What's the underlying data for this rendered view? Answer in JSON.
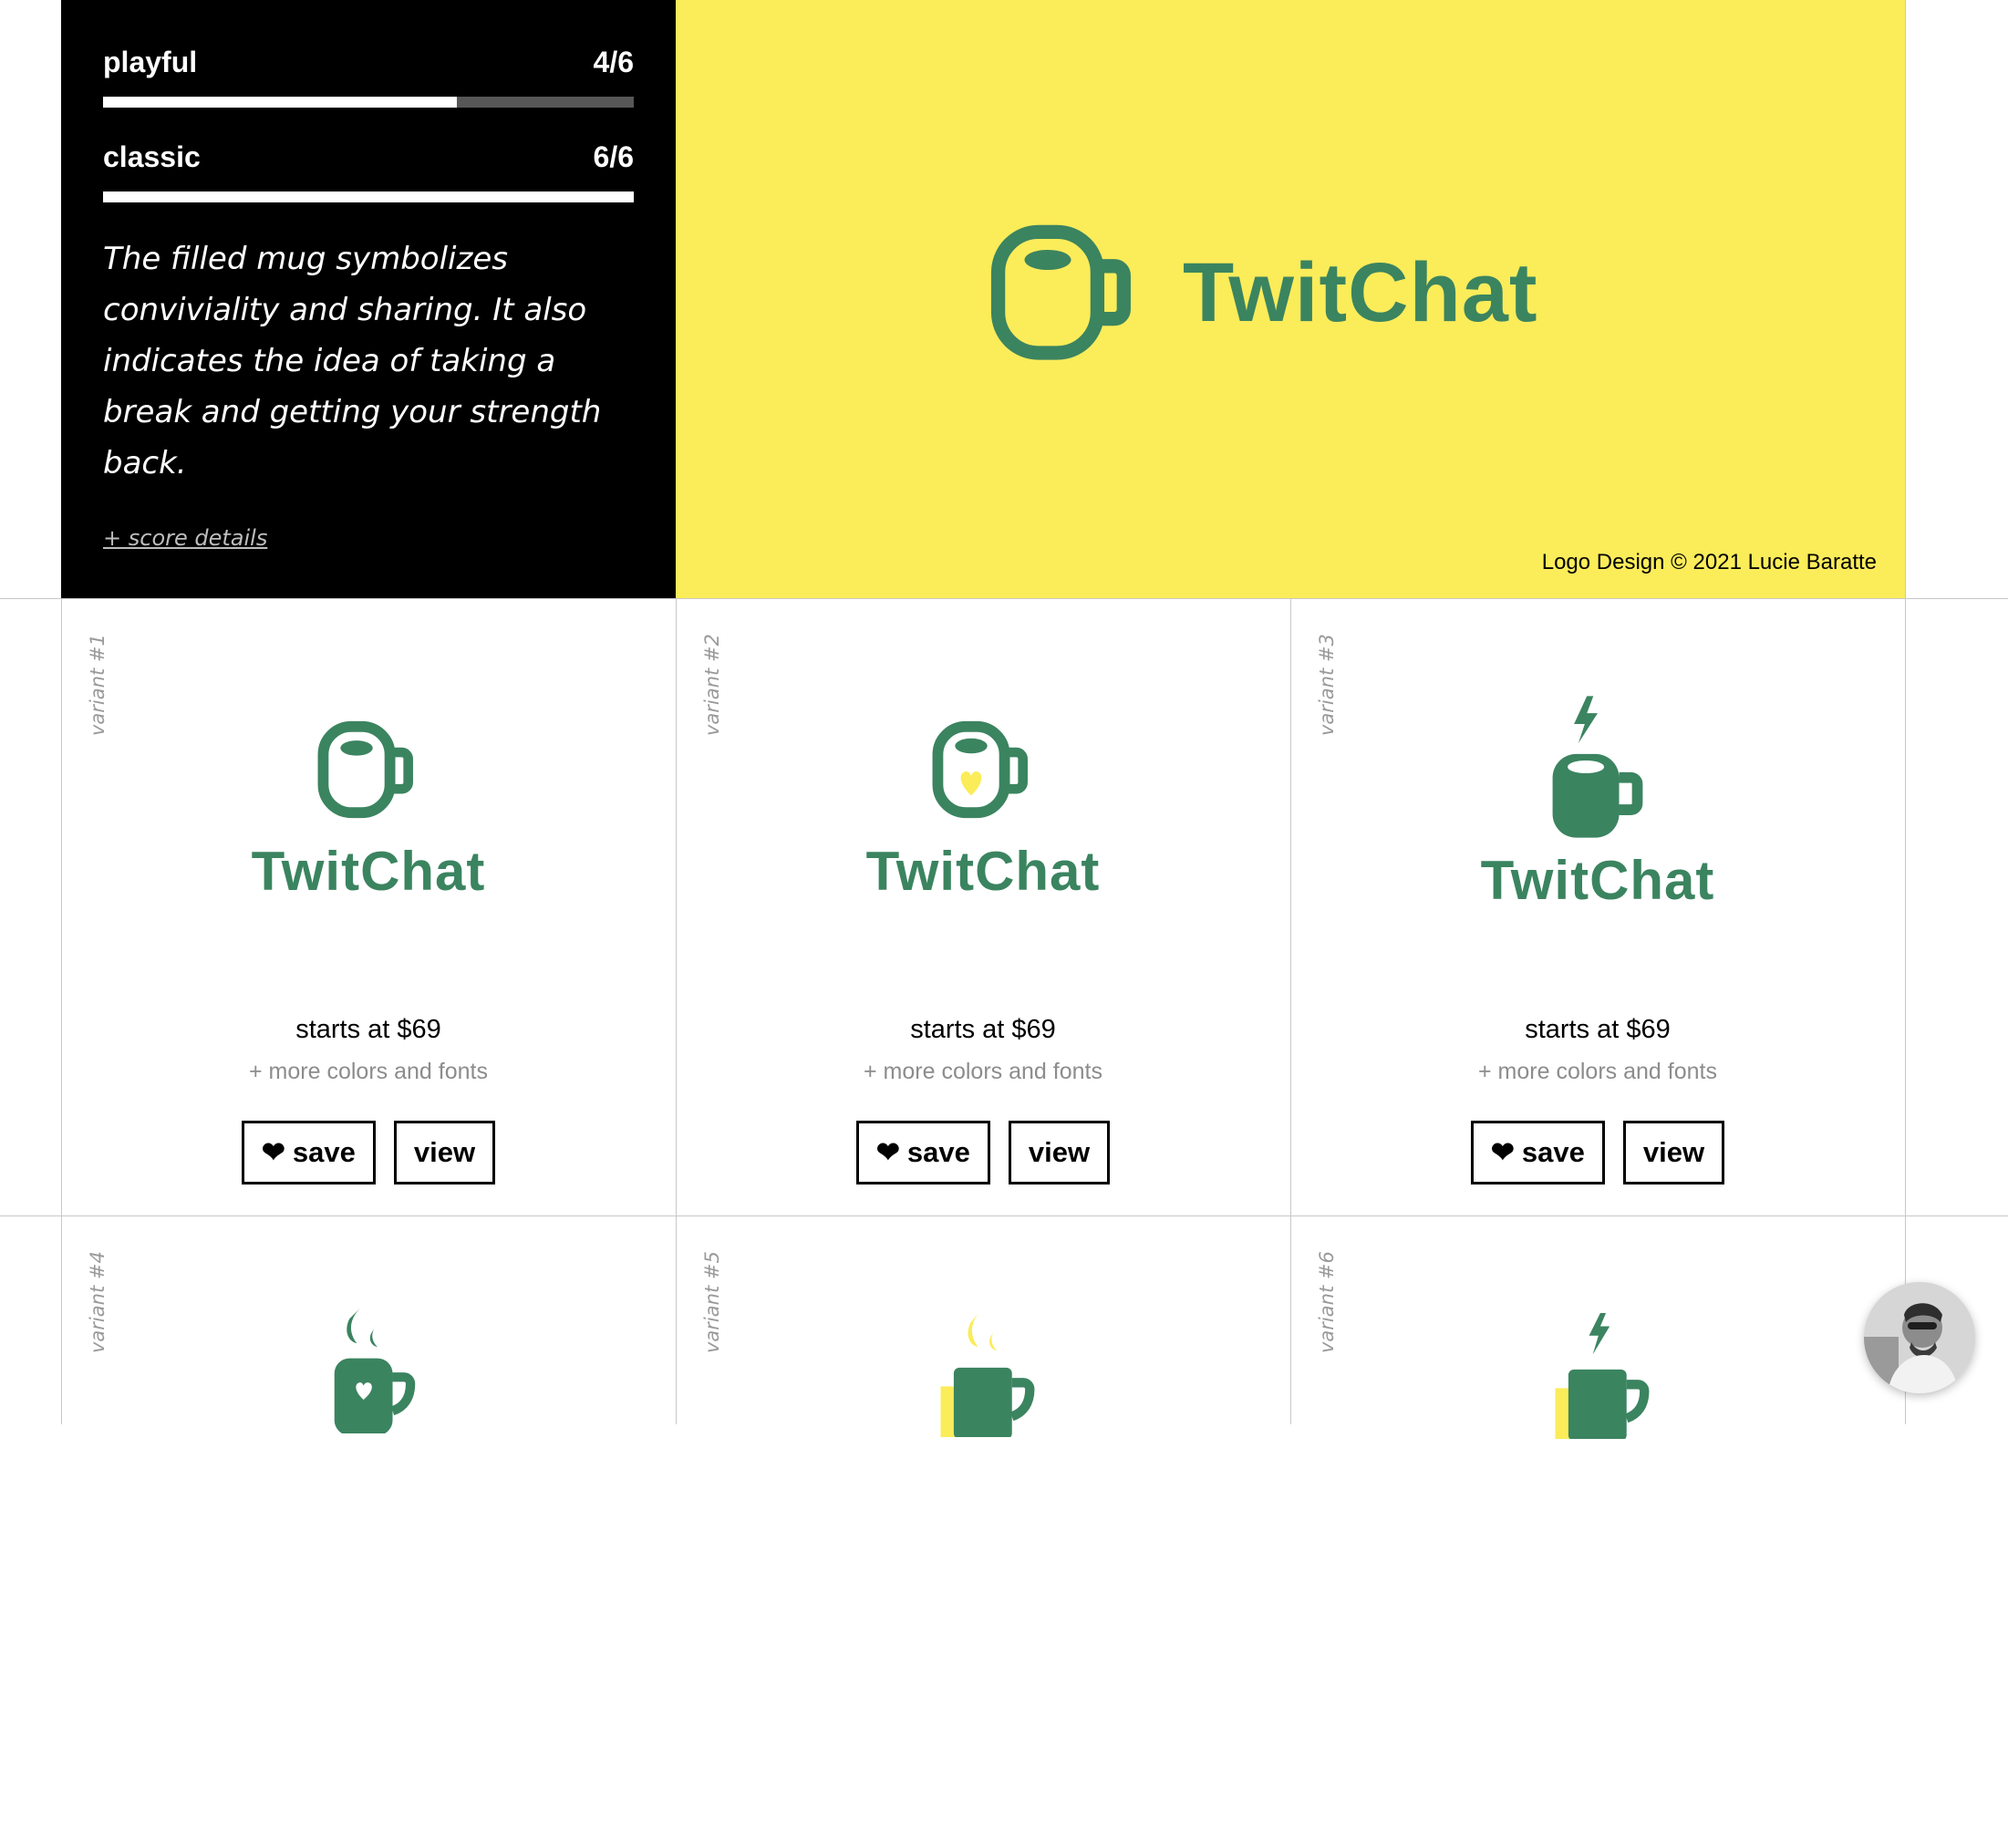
{
  "colors": {
    "brand_green": "#3b8460",
    "brand_yellow": "#fbec5a",
    "panel_black": "#000000"
  },
  "info": {
    "scores": [
      {
        "name": "playful",
        "value": "4/6",
        "fill": 0.667
      },
      {
        "name": "classic",
        "value": "6/6",
        "fill": 1.0
      }
    ],
    "description": "The filled mug symbolizes conviviality and sharing. It also indicates the idea of taking a break and getting your strength back.",
    "details_link": "+ score details"
  },
  "hero": {
    "brand_name": "TwitChat",
    "icon": "mug-icon",
    "credit": "Logo Design © 2021 Lucie Baratte"
  },
  "variants": [
    {
      "label": "variant #1",
      "brand_name": "TwitChat",
      "icon": "mug-outline-icon",
      "price": "starts at $69",
      "more": "+ more colors and fonts",
      "save_label": "save",
      "view_label": "view"
    },
    {
      "label": "variant #2",
      "brand_name": "TwitChat",
      "icon": "mug-heart-icon",
      "price": "starts at $69",
      "more": "+ more colors and fonts",
      "save_label": "save",
      "view_label": "view"
    },
    {
      "label": "variant #3",
      "brand_name": "TwitChat",
      "icon": "mug-bolt-icon",
      "price": "starts at $69",
      "more": "+ more colors and fonts",
      "save_label": "save",
      "view_label": "view"
    },
    {
      "label": "variant #4",
      "icon": "mug-steam-heart-icon"
    },
    {
      "label": "variant #5",
      "icon": "mug-steam-yellow-icon"
    },
    {
      "label": "variant #6",
      "icon": "mug-bolt-yellow-icon"
    }
  ],
  "icons": {
    "save": "heart-icon",
    "chat": "avatar"
  }
}
